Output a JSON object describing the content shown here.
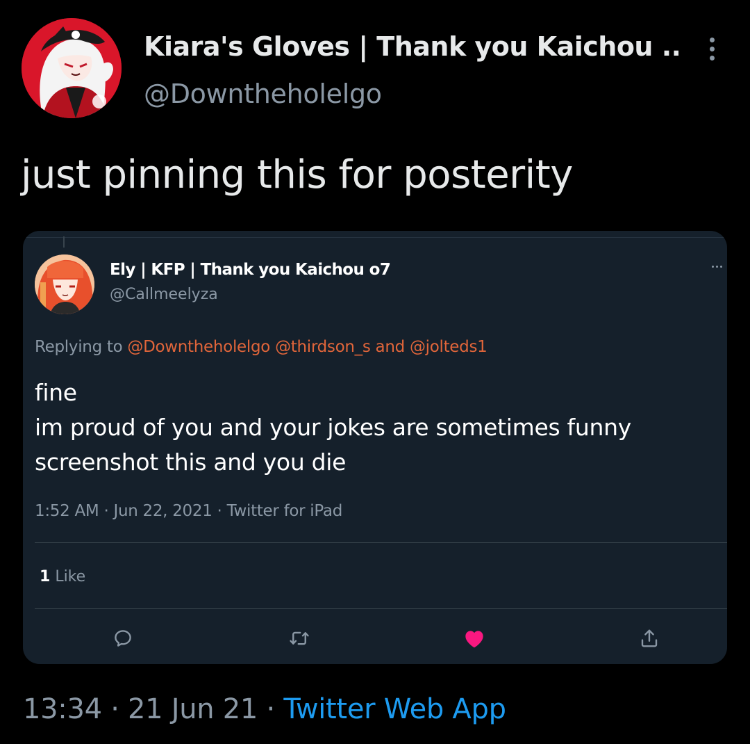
{
  "tweet": {
    "author": {
      "display_name": "Kiara's Gloves | Thank you Kaichou ...",
      "handle": "@Downtheholelgo",
      "avatar_icon": "avatar-anime-redhat"
    },
    "menu_icon": "more-vertical-icon",
    "text": "just pinning this for posterity",
    "footer": {
      "time": "13:34",
      "date": "21 Jun 21",
      "separator": " · ",
      "source": "Twitter Web App"
    }
  },
  "quoted": {
    "author": {
      "display_name": "Ely | KFP | Thank you Kaichou o7",
      "handle": "@Callmeelyza",
      "avatar_icon": "avatar-anime-orange-hair"
    },
    "replying": {
      "prefix": "Replying to",
      "mention_1": "@Downtheholelgo",
      "mention_2": "@thirdson_s",
      "joiner": "and",
      "mention_3": "@jolteds1"
    },
    "lines": [
      "fine",
      "im proud of you and your jokes are sometimes funny",
      "screenshot this and you die"
    ],
    "timestamp": "1:52 AM · Jun 22, 2021 · Twitter for iPad",
    "likes": {
      "count": "1",
      "label": "Like"
    },
    "actions": {
      "reply": "reply-icon",
      "retweet": "retweet-icon",
      "like": "heart-icon",
      "share": "share-icon"
    }
  },
  "colors": {
    "background": "#000000",
    "card_background": "#15202b",
    "secondary_text": "#8b98a5",
    "mention": "#e0653a",
    "link": "#1d9bf0",
    "like": "#f91880"
  }
}
